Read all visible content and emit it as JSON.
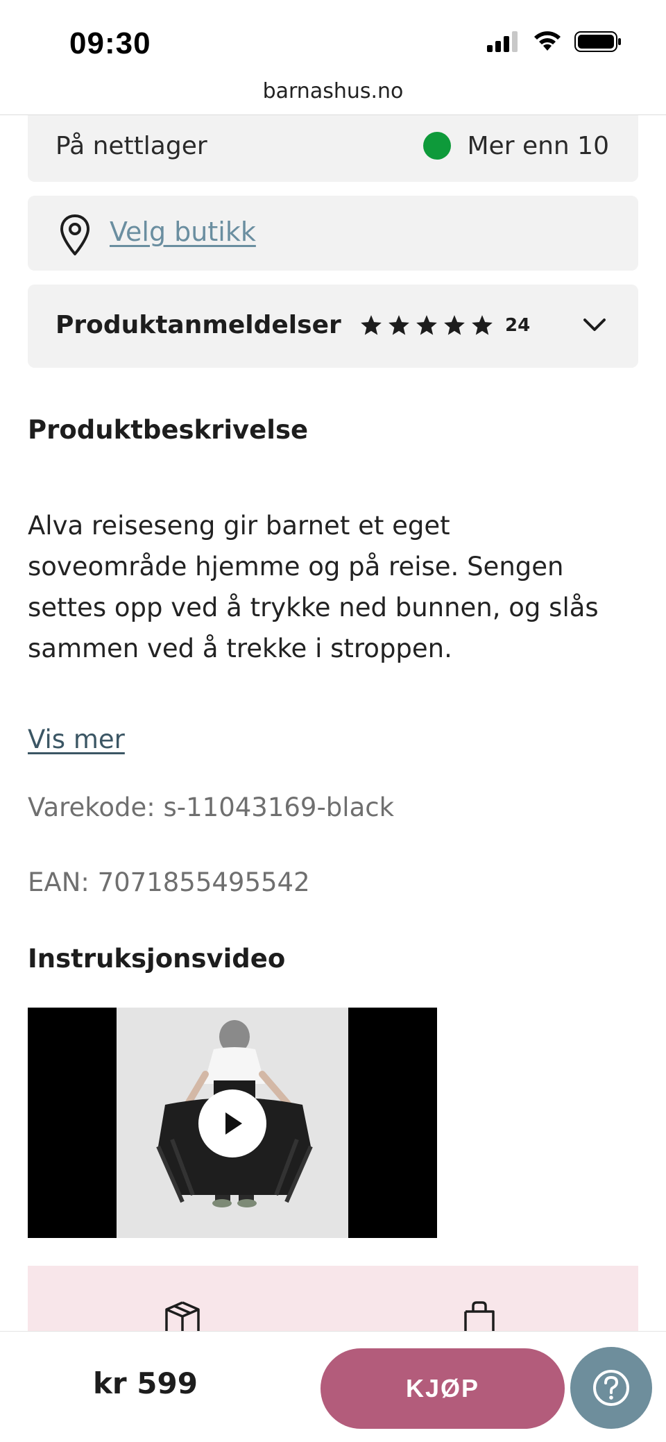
{
  "status_bar": {
    "time": "09:30",
    "icons": [
      "signal-icon",
      "wifi-icon",
      "battery-icon"
    ]
  },
  "browser": {
    "url": "barnashus.no"
  },
  "stock": {
    "label": "På nettlager",
    "value": "Mer enn 10",
    "status_color": "#0e9a3a"
  },
  "store": {
    "icon": "location-pin-icon",
    "link": "Velg butikk"
  },
  "reviews": {
    "title": "Produktanmeldelser",
    "rating_stars": 5,
    "count": "24",
    "icon": "chevron-down-icon"
  },
  "description": {
    "title": "Produktbeskrivelse",
    "lines": [
      "Alva reiseseng gir barnet et eget",
      "soveområde hjemme og på reise. Sengen",
      "settes opp ved å trykke ned bunnen, og slås",
      "sammen ved å trekke i stroppen."
    ],
    "show_more": "Vis mer",
    "sku": "Varekode: s-11043169-black",
    "ean": "EAN: 7071855495542"
  },
  "video": {
    "title": "Instruksjonsvideo",
    "icon": "play-icon"
  },
  "usp": {
    "icons": [
      "package-icon",
      "shopping-bag-icon"
    ],
    "background": "#f8e6ea"
  },
  "bottom_bar": {
    "price": "kr 599",
    "buy_label": "KJØP",
    "buy_color": "#b35c7b",
    "help_icon": "question-icon",
    "help_color": "#6e8e9c"
  }
}
